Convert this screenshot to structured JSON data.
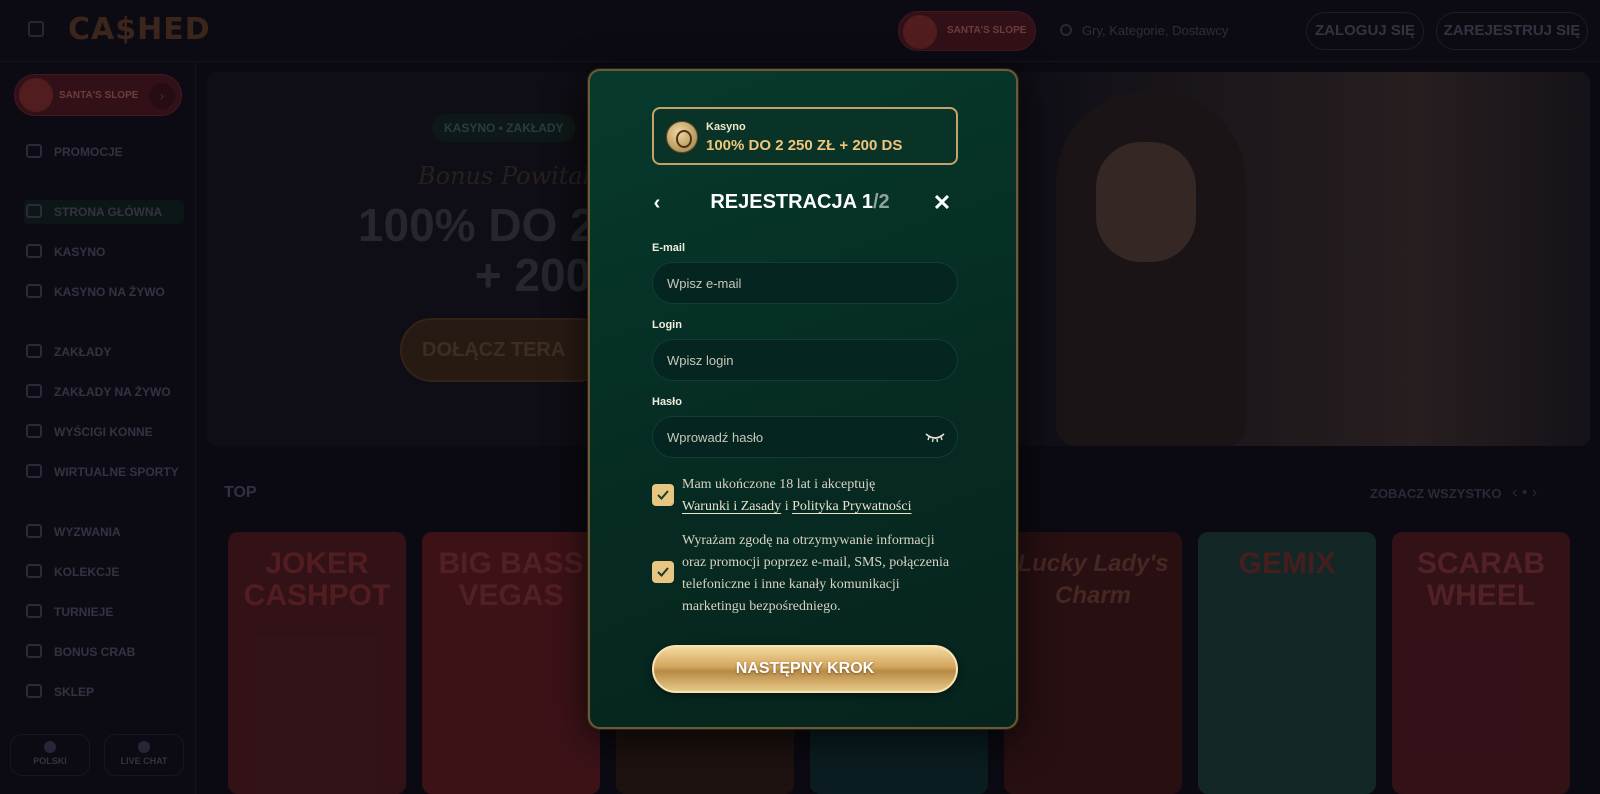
{
  "header": {
    "logo": "CA$HED",
    "santa_label": "SANTA'S SLOPE",
    "search_placeholder": "Gry, Kategorie, Dostawcy",
    "login_label": "ZALOGUJ SIĘ",
    "register_label": "ZAREJESTRUJ SIĘ"
  },
  "sidebar": {
    "santa_label": "SANTA'S SLOPE",
    "items": [
      {
        "label": "PROMOCJE",
        "icon": "gift-icon"
      },
      {
        "label": "STRONA GŁÓWNA",
        "icon": "home-icon"
      },
      {
        "label": "KASYNO",
        "icon": "slot-icon"
      },
      {
        "label": "KASYNO NA ŻYWO",
        "icon": "live-casino-icon"
      },
      {
        "label": "ZAKŁADY",
        "icon": "ball-icon"
      },
      {
        "label": "ZAKŁADY NA ŻYWO",
        "icon": "live-bets-icon"
      },
      {
        "label": "WYŚCIGI KONNE",
        "icon": "horse-icon"
      },
      {
        "label": "WIRTUALNE SPORTY",
        "icon": "virtual-sports-icon"
      },
      {
        "label": "WYZWANIA",
        "icon": "challenge-icon"
      },
      {
        "label": "KOLEKCJE",
        "icon": "collection-icon"
      },
      {
        "label": "TURNIEJE",
        "icon": "trophy-icon"
      },
      {
        "label": "BONUS CRAB",
        "icon": "crab-icon"
      },
      {
        "label": "SKLEP",
        "icon": "shop-icon"
      }
    ],
    "language_label": "POLSKI",
    "live_chat_label": "LIVE CHAT"
  },
  "hero": {
    "breadcrumb": "KASYNO  •  ZAKŁADY",
    "script": "Bonus Powitalny",
    "title_line1": "100% DO 2 2",
    "title_line2": "+ 200 D",
    "cta": "DOŁĄCZ TERA"
  },
  "games": {
    "section_title": "TOP",
    "see_all": "ZOBACZ WSZYSTKO",
    "tiles": [
      {
        "title": "JOKER CASHPOT",
        "color": "#4a1a1e"
      },
      {
        "title": "BIG BASS VEGAS",
        "color": "#5a1a20"
      },
      {
        "title": "",
        "color": "#2a1a14"
      },
      {
        "title": "",
        "color": "#0f2a2e"
      },
      {
        "title": "Lucky Lady's Charm",
        "color": "#3a1418"
      },
      {
        "title": "GEMIX",
        "color": "#1a3a36"
      },
      {
        "title": "SCARAB WHEEL",
        "color": "#4a1820"
      }
    ]
  },
  "modal": {
    "promo_category": "Kasyno",
    "promo_offer": "100% DO 2 250 ZŁ + 200 DS",
    "title_main": "REJESTRACJA 1",
    "title_total": "/2",
    "email_label": "E-mail",
    "email_placeholder": "Wpisz e-mail",
    "login_label": "Login",
    "login_placeholder": "Wpisz login",
    "password_label": "Hasło",
    "password_placeholder": "Wprowadź hasło",
    "terms_text_1": "Mam ukończone 18 lat i akceptuję",
    "terms_link_1": "Warunki i Zasady",
    "terms_and": " i ",
    "terms_link_2": "Polityka Prywatności",
    "consent_text": "Wyrażam zgodę na otrzymywanie informacji oraz promocji poprzez e-mail, SMS, połączenia telefoniczne i inne kanały komunikacji marketingu bezpośredniego.",
    "terms_checked": true,
    "consent_checked": true,
    "next_label": "NASTĘPNY KROK",
    "accent_color": "#e8c682",
    "background_color": "#073a2d"
  }
}
